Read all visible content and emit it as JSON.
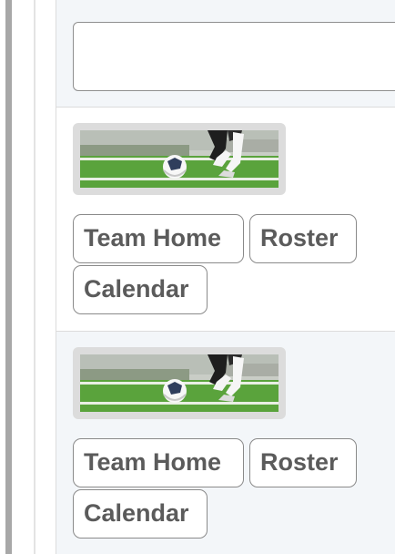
{
  "search": {
    "value": "",
    "placeholder": ""
  },
  "teams": [
    {
      "image_icon": "soccer-player-photo",
      "links": {
        "home": "Team Home",
        "roster": "Roster",
        "calendar": "Calendar"
      }
    },
    {
      "image_icon": "soccer-player-photo",
      "links": {
        "home": "Team Home",
        "roster": "Roster",
        "calendar": "Calendar"
      }
    }
  ],
  "colors": {
    "panel_bg": "#f3f6f9",
    "chip_text": "#5b5b5b",
    "chip_border": "#8a8a8a",
    "rail": "#a8a8a8",
    "grass": "#5aa33c"
  }
}
